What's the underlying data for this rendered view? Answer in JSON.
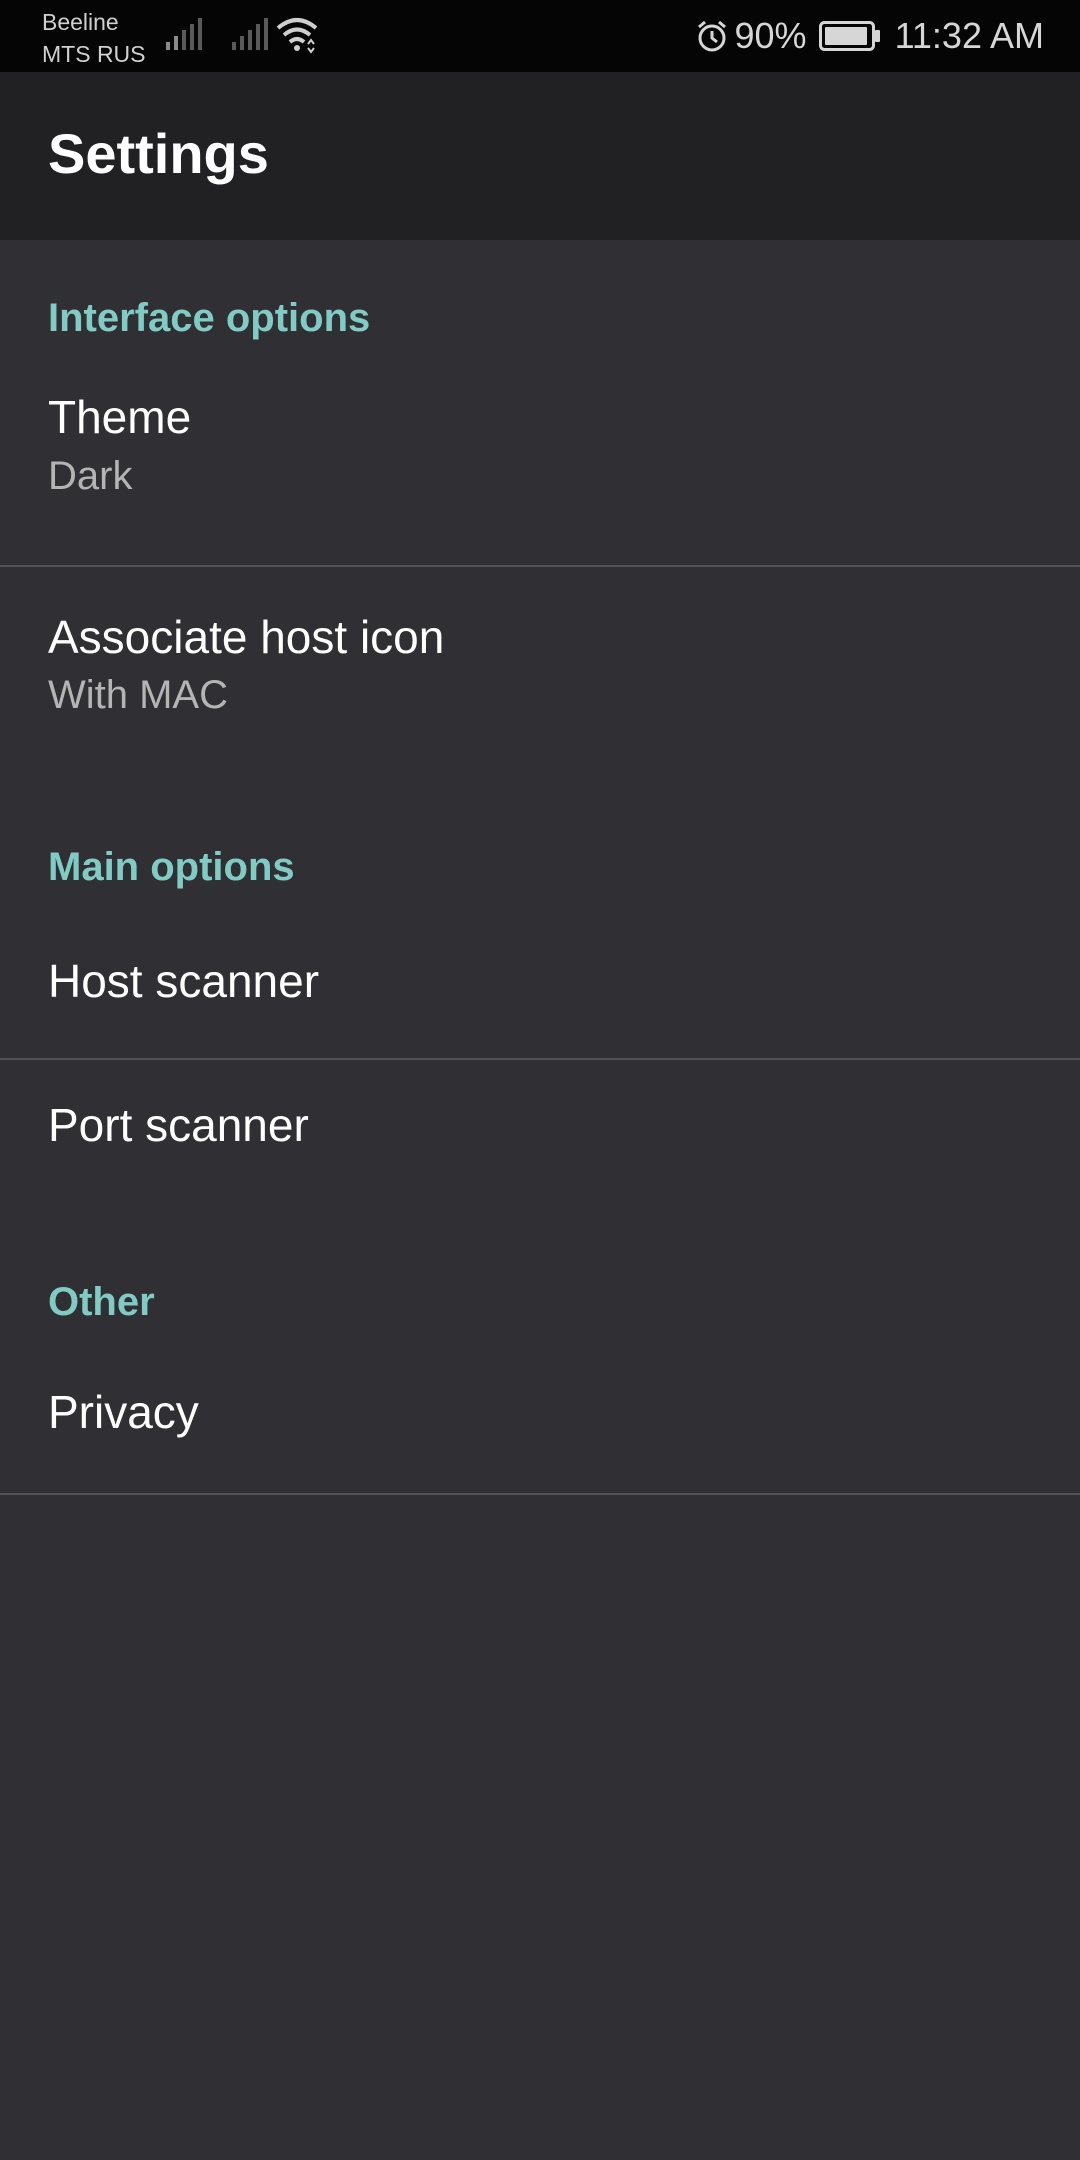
{
  "status_bar": {
    "carrier_1": "Beeline",
    "carrier_2": "MTS RUS",
    "battery_percent": "90%",
    "time": "11:32 AM",
    "icons": [
      "signal-icon",
      "signal-icon",
      "wifi-icon",
      "alarm-icon",
      "battery-icon"
    ]
  },
  "app_bar": {
    "title": "Settings"
  },
  "sections": {
    "interface": {
      "header": "Interface options",
      "theme": {
        "title": "Theme",
        "summary": "Dark"
      },
      "host_icon": {
        "title": "Associate host icon",
        "summary": "With MAC"
      }
    },
    "main": {
      "header": "Main options",
      "host_scanner": {
        "title": "Host scanner"
      },
      "port_scanner": {
        "title": "Port scanner"
      }
    },
    "other": {
      "header": "Other",
      "privacy": {
        "title": "Privacy"
      }
    }
  },
  "colors": {
    "accent": "#80cbc4",
    "background": "#302f33",
    "app_bar": "#212023",
    "status_bar": "#050505"
  }
}
